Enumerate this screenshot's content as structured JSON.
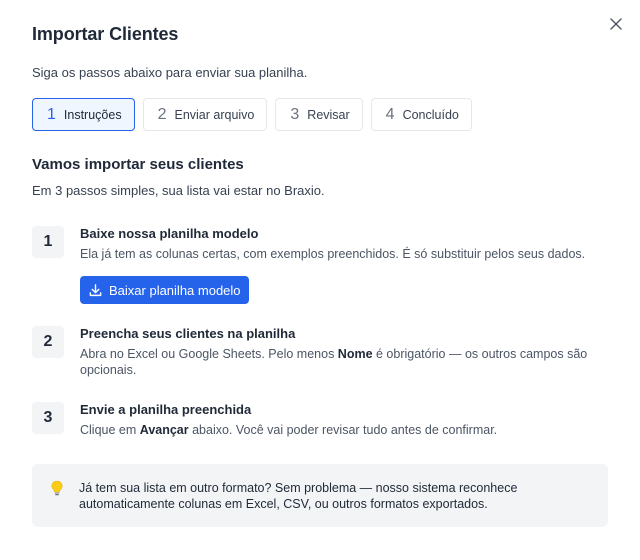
{
  "dialog": {
    "title": "Importar Clientes",
    "subtitle": "Siga os passos abaixo para enviar sua planilha.",
    "close_icon": "close-icon"
  },
  "steps": [
    {
      "num": "1",
      "label": "Instruções",
      "active": true
    },
    {
      "num": "2",
      "label": "Enviar arquivo",
      "active": false
    },
    {
      "num": "3",
      "label": "Revisar",
      "active": false
    },
    {
      "num": "4",
      "label": "Concluído",
      "active": false
    }
  ],
  "intro": {
    "title": "Vamos importar seus clientes",
    "subtitle": "Em 3 passos simples, sua lista vai estar no Braxio."
  },
  "items": [
    {
      "num": "1",
      "title": "Baixe nossa planilha modelo",
      "desc": "Ela já tem as colunas certas, com exemplos preenchidos. É só substituir pelos seus dados.",
      "button_label": "Baixar planilha modelo",
      "button_icon": "download-icon"
    },
    {
      "num": "2",
      "title": "Preencha seus clientes na planilha",
      "desc_before": "Abra no Excel ou Google Sheets. Pelo menos ",
      "desc_bold": "Nome",
      "desc_after": " é obrigatório — os outros campos são opcionais."
    },
    {
      "num": "3",
      "title": "Envie a planilha preenchida",
      "desc_before": "Clique em ",
      "desc_bold": "Avançar",
      "desc_after": " abaixo. Você vai poder revisar tudo antes de confirmar."
    }
  ],
  "tip": {
    "icon": "lightbulb-icon",
    "text": "Já tem sua lista em outro formato? Sem problema — nosso sistema reconhece automaticamente colunas em Excel, CSV, ou outros formatos exportados."
  },
  "colors": {
    "accent": "#2563eb",
    "active_step_bg": "#eff6ff",
    "badge_bg": "#f3f4f6",
    "tip_bg": "#f3f4f6"
  }
}
